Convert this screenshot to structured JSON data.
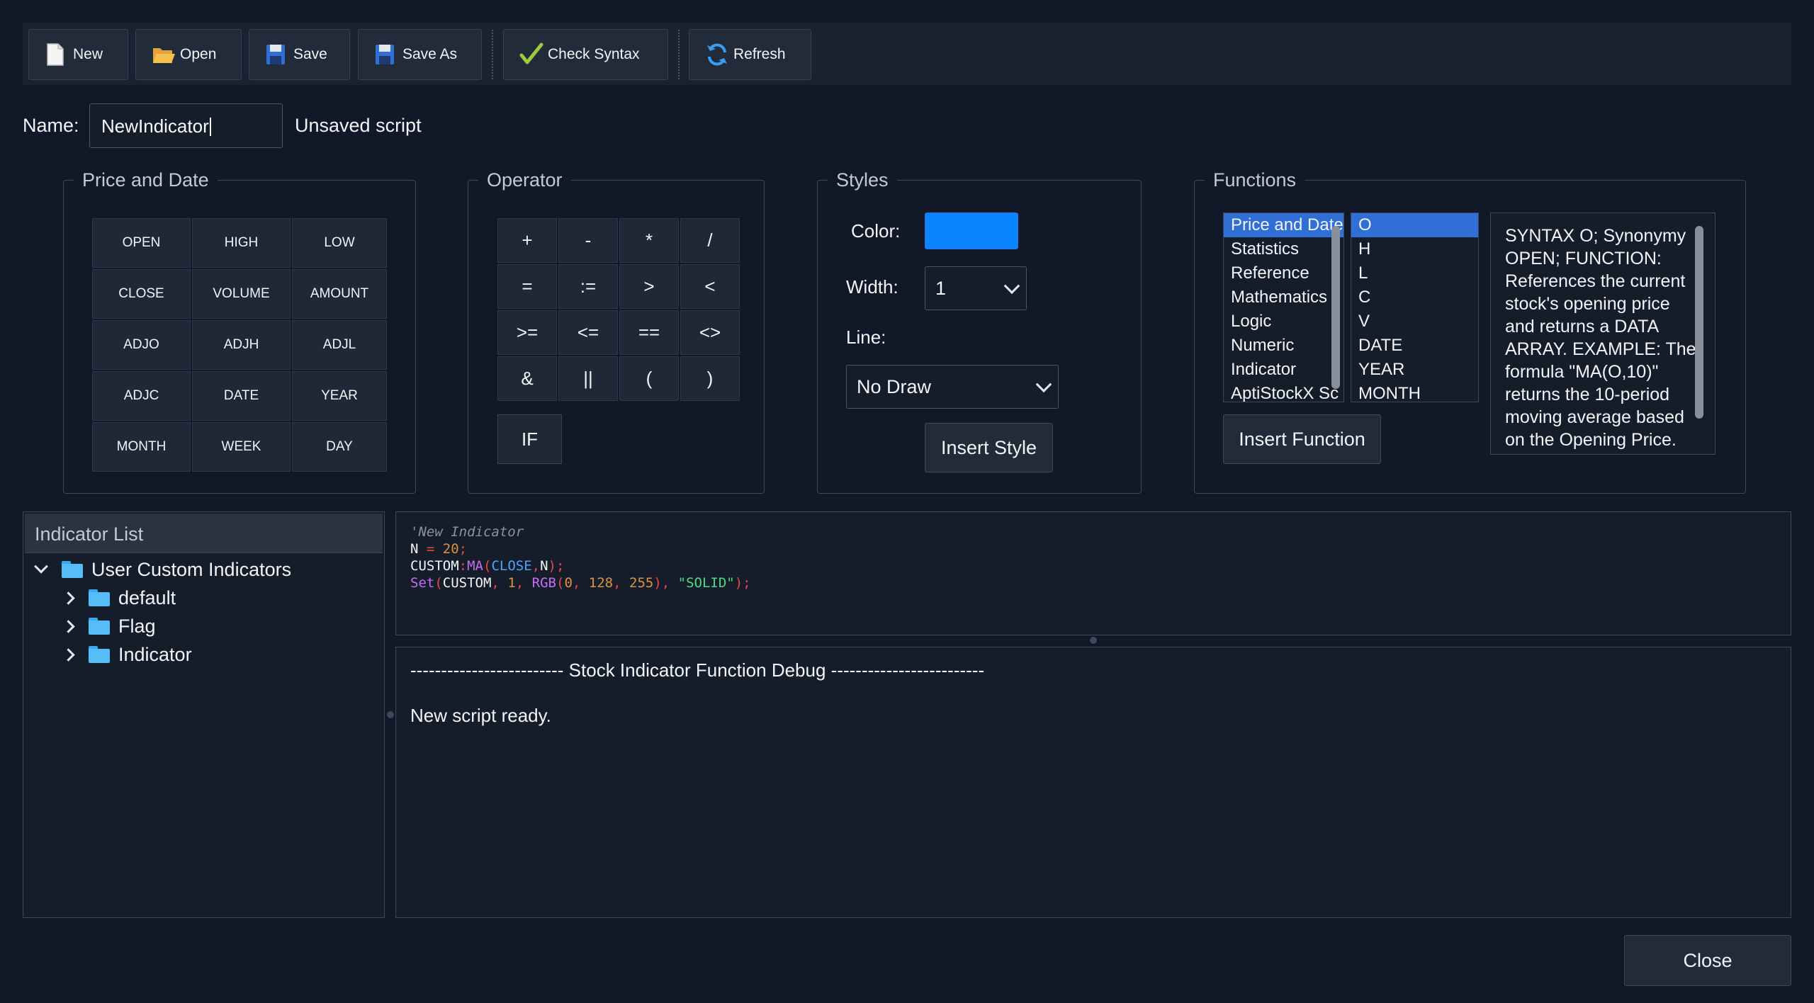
{
  "toolbar": {
    "new_label": "New",
    "open_label": "Open",
    "save_label": "Save",
    "save_as_label": "Save As",
    "check_syntax_label": "Check Syntax",
    "refresh_label": "Refresh"
  },
  "name_row": {
    "label": "Name:",
    "value": "NewIndicator",
    "status": "Unsaved script"
  },
  "price_and_date": {
    "title": "Price and Date",
    "buttons": [
      "OPEN",
      "HIGH",
      "LOW",
      "CLOSE",
      "VOLUME",
      "AMOUNT",
      "ADJO",
      "ADJH",
      "ADJL",
      "ADJC",
      "DATE",
      "YEAR",
      "MONTH",
      "WEEK",
      "DAY"
    ]
  },
  "operator": {
    "title": "Operator",
    "buttons": [
      "+",
      "-",
      "*",
      "/",
      "=",
      ":=",
      ">",
      "<",
      ">=",
      "<=",
      "==",
      "<>",
      "&",
      "||",
      "(",
      ")"
    ],
    "if_label": "IF"
  },
  "styles": {
    "title": "Styles",
    "color_label": "Color:",
    "color_value": "#0a84ff",
    "width_label": "Width:",
    "width_value": "1",
    "line_label": "Line:",
    "line_value": "No Draw",
    "insert_label": "Insert Style"
  },
  "functions": {
    "title": "Functions",
    "categories": [
      "Price and Date",
      "Statistics",
      "Reference",
      "Mathematics",
      "Logic",
      "Numeric",
      "Indicator",
      "AptiStockX Sc"
    ],
    "selected_category": 0,
    "items": [
      "O",
      "H",
      "L",
      "C",
      "V",
      "DATE",
      "YEAR",
      "MONTH"
    ],
    "selected_item": 0,
    "insert_label": "Insert Function",
    "description": "SYNTAX O; Synonymy OPEN; FUNCTION: References the current stock's opening price and returns a DATA ARRAY. EXAMPLE: The formula \"MA(O,10)\" returns the 10-period moving average based on the Opening Price."
  },
  "indicator_list": {
    "title": "Indicator List",
    "root": "User Custom Indicators",
    "children": [
      "default",
      "Flag",
      "Indicator"
    ]
  },
  "editor": {
    "line1": "'New Indicator",
    "line2_a": "N",
    "line2_b": " = ",
    "line2_c": "20",
    "line2_d": ";",
    "line3_a": "CUSTOM",
    "line3_b": ":",
    "line3_c": "MA",
    "line3_d": "(",
    "line3_e": "CLOSE",
    "line3_f": ",",
    "line3_g": "N",
    "line3_h": ");",
    "line4_a": "Set",
    "line4_b": "(",
    "line4_c": "CUSTOM",
    "line4_d": ", ",
    "line4_e": "1",
    "line4_f": ", ",
    "line4_g": "RGB",
    "line4_h": "(",
    "line4_i": "0",
    "line4_j": ", ",
    "line4_k": "128",
    "line4_l": ", ",
    "line4_m": "255",
    "line4_n": "), ",
    "line4_o": "\"SOLID\"",
    "line4_p": ");"
  },
  "debug": {
    "header": "------------------------- Stock Indicator Function Debug -------------------------",
    "message": "New script ready."
  },
  "close_label": "Close"
}
